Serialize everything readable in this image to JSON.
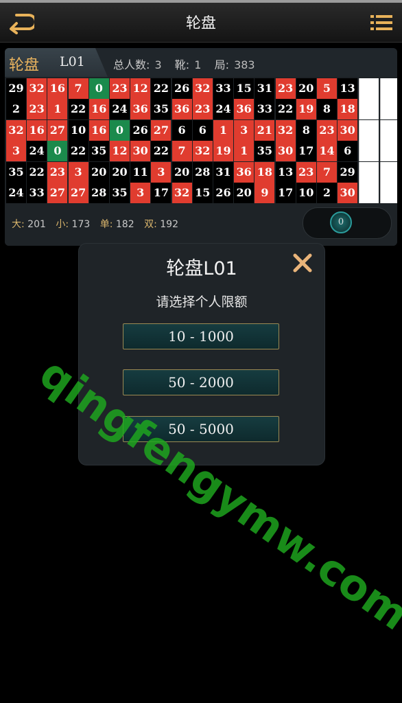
{
  "header": {
    "title": "轮盘",
    "back_icon": "back-arrow-icon",
    "menu_icon": "list-menu-icon"
  },
  "table_panel": {
    "name": "轮盘",
    "code": "L01",
    "stats": {
      "players_label": "总人数:",
      "players_value": "3",
      "shoe_label": "靴:",
      "shoe_value": "1",
      "round_label": "局:",
      "round_value": "383"
    },
    "history": [
      [
        [
          29,
          "b"
        ],
        [
          32,
          "r"
        ],
        [
          16,
          "r"
        ],
        [
          7,
          "r"
        ],
        [
          0,
          "g"
        ],
        [
          23,
          "r"
        ],
        [
          12,
          "r"
        ],
        [
          22,
          "b"
        ],
        [
          26,
          "b"
        ],
        [
          32,
          "r"
        ],
        [
          33,
          "b"
        ],
        [
          15,
          "b"
        ],
        [
          31,
          "b"
        ],
        [
          23,
          "r"
        ],
        [
          20,
          "b"
        ],
        [
          5,
          "r"
        ],
        [
          13,
          "b"
        ]
      ],
      [
        [
          2,
          "b"
        ],
        [
          23,
          "r"
        ],
        [
          1,
          "r"
        ],
        [
          22,
          "b"
        ],
        [
          16,
          "r"
        ],
        [
          24,
          "b"
        ],
        [
          36,
          "r"
        ],
        [
          35,
          "b"
        ],
        [
          36,
          "r"
        ],
        [
          23,
          "r"
        ],
        [
          24,
          "b"
        ],
        [
          36,
          "r"
        ],
        [
          33,
          "b"
        ],
        [
          22,
          "b"
        ],
        [
          19,
          "r"
        ],
        [
          8,
          "b"
        ],
        [
          18,
          "r"
        ]
      ],
      [
        [
          32,
          "r"
        ],
        [
          16,
          "r"
        ],
        [
          27,
          "r"
        ],
        [
          10,
          "b"
        ],
        [
          16,
          "r"
        ],
        [
          0,
          "g"
        ],
        [
          26,
          "b"
        ],
        [
          27,
          "r"
        ],
        [
          6,
          "b"
        ],
        [
          6,
          "b"
        ],
        [
          1,
          "r"
        ],
        [
          3,
          "r"
        ],
        [
          21,
          "r"
        ],
        [
          32,
          "r"
        ],
        [
          8,
          "b"
        ],
        [
          23,
          "r"
        ],
        [
          30,
          "r"
        ]
      ],
      [
        [
          3,
          "r"
        ],
        [
          24,
          "b"
        ],
        [
          0,
          "g"
        ],
        [
          22,
          "b"
        ],
        [
          35,
          "b"
        ],
        [
          12,
          "r"
        ],
        [
          30,
          "r"
        ],
        [
          22,
          "b"
        ],
        [
          7,
          "r"
        ],
        [
          32,
          "r"
        ],
        [
          19,
          "r"
        ],
        [
          1,
          "r"
        ],
        [
          35,
          "b"
        ],
        [
          30,
          "r"
        ],
        [
          17,
          "b"
        ],
        [
          14,
          "r"
        ],
        [
          6,
          "b"
        ]
      ],
      [
        [
          35,
          "b"
        ],
        [
          22,
          "b"
        ],
        [
          23,
          "r"
        ],
        [
          3,
          "r"
        ],
        [
          20,
          "b"
        ],
        [
          20,
          "b"
        ],
        [
          11,
          "b"
        ],
        [
          3,
          "r"
        ],
        [
          20,
          "b"
        ],
        [
          28,
          "b"
        ],
        [
          31,
          "b"
        ],
        [
          36,
          "r"
        ],
        [
          18,
          "r"
        ],
        [
          13,
          "b"
        ],
        [
          23,
          "r"
        ],
        [
          7,
          "r"
        ],
        [
          29,
          "b"
        ]
      ],
      [
        [
          24,
          "b"
        ],
        [
          33,
          "b"
        ],
        [
          27,
          "r"
        ],
        [
          27,
          "r"
        ],
        [
          28,
          "b"
        ],
        [
          35,
          "b"
        ],
        [
          3,
          "r"
        ],
        [
          17,
          "b"
        ],
        [
          32,
          "r"
        ],
        [
          15,
          "b"
        ],
        [
          26,
          "b"
        ],
        [
          20,
          "b"
        ],
        [
          9,
          "r"
        ],
        [
          17,
          "b"
        ],
        [
          10,
          "b"
        ],
        [
          2,
          "b"
        ],
        [
          30,
          "r"
        ]
      ]
    ],
    "footer": {
      "big_label": "大:",
      "big_value": "201",
      "small_label": "小:",
      "small_value": "173",
      "odd_label": "单:",
      "odd_value": "182",
      "even_label": "双:",
      "even_value": "192",
      "last_result": "0"
    }
  },
  "colors": {
    "red": "#e03c2f",
    "black": "#000000",
    "green": "#1b8a4c",
    "accent_gold": "#e9b35e"
  },
  "modal": {
    "title": "轮盘L01",
    "subtitle": "请选择个人限额",
    "close_icon": "close-x-icon",
    "options": [
      {
        "label": "10 - 1000"
      },
      {
        "label": "50 - 2000"
      },
      {
        "label": "50 - 5000"
      }
    ]
  },
  "watermark": "qingfengymw.com"
}
